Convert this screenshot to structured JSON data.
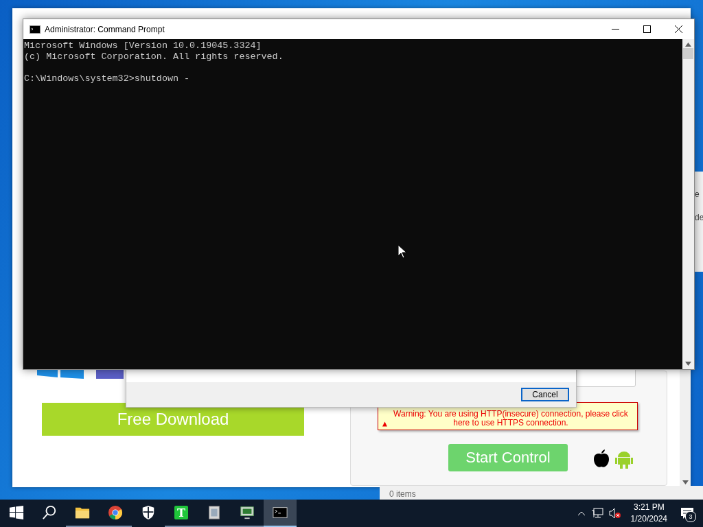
{
  "browser": {
    "free_download": "Free Download",
    "dialog": {
      "cancel": "Cancel"
    },
    "warning": "Warning: You are using HTTP(insecure) connection, please click here to use HTTPS connection.",
    "start_control": "Start Control"
  },
  "side_window": {
    "fragments": [
      "e",
      "de"
    ]
  },
  "explorer": {
    "status": "0 items"
  },
  "console": {
    "title": "Administrator: Command Prompt",
    "header": [
      "Microsoft Windows [Version 10.0.19045.3324]",
      "(c) Microsoft Corporation. All rights reserved."
    ],
    "prompt": "C:\\Windows\\system32>shutdown -"
  },
  "taskbar": {
    "items": [
      {
        "kind": "start",
        "selected": false,
        "running": false
      },
      {
        "kind": "search",
        "selected": false,
        "running": false
      },
      {
        "kind": "folder",
        "selected": false,
        "running": true
      },
      {
        "kind": "chrome",
        "selected": false,
        "running": true
      },
      {
        "kind": "shield",
        "selected": false,
        "running": false
      },
      {
        "kind": "letter",
        "glyph": "T",
        "selected": false,
        "running": true
      },
      {
        "kind": "archive",
        "selected": false,
        "running": true
      },
      {
        "kind": "monitor",
        "selected": false,
        "running": true
      },
      {
        "kind": "terminal",
        "selected": true,
        "running": true
      }
    ],
    "time": "3:21 PM",
    "date": "1/20/2024",
    "notifications": "3"
  }
}
